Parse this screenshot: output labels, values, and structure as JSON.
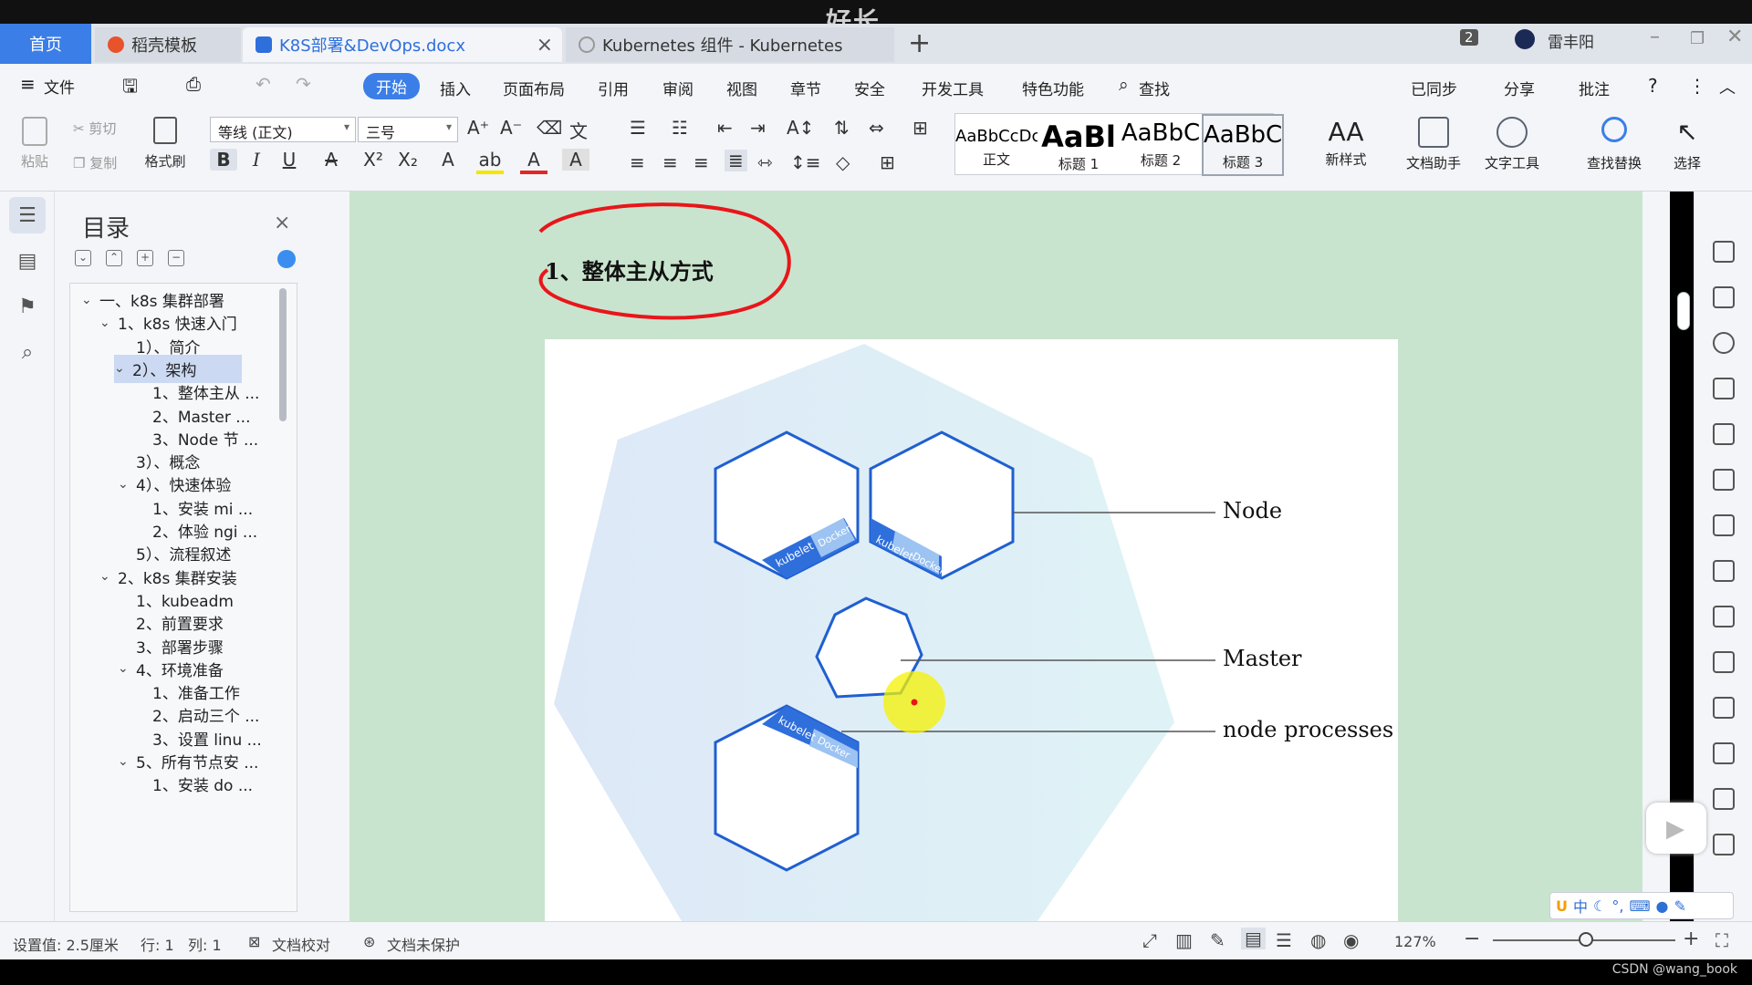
{
  "overlay_title": "好长",
  "tabs": {
    "home": "首页",
    "template": "稻壳模板",
    "doc": "K8S部署&DevOps.docx",
    "browser": "Kubernetes 组件 - Kubernetes",
    "badge": "2",
    "user": "雷丰阳"
  },
  "menu": {
    "file": "文件",
    "items": [
      "开始",
      "插入",
      "页面布局",
      "引用",
      "审阅",
      "视图",
      "章节",
      "安全",
      "开发工具",
      "特色功能"
    ],
    "search": "查找",
    "synced": "已同步",
    "share": "分享",
    "comment": "批注"
  },
  "ribbon": {
    "paste": "粘贴",
    "cut": "剪切",
    "copy": "复制",
    "format_painter": "格式刷",
    "font_name": "等线 (正文)",
    "font_size": "三号",
    "styles": [
      {
        "sample": "AaBbCcDc",
        "name": "正文"
      },
      {
        "sample": "AaBl",
        "name": "标题 1"
      },
      {
        "sample": "AaBbC",
        "name": "标题 2"
      },
      {
        "sample": "AaBbC",
        "name": "标题 3"
      }
    ],
    "new_style": "新样式",
    "doc_helper": "文档助手",
    "text_tools": "文字工具",
    "find_replace": "查找替换",
    "select": "选择"
  },
  "toc": {
    "title": "目录",
    "items": [
      {
        "level": 0,
        "toggle": "v",
        "label": "一、k8s 集群部署"
      },
      {
        "level": 1,
        "toggle": "v",
        "label": "1、k8s 快速入门"
      },
      {
        "level": 2,
        "toggle": "",
        "label": "1）、简介"
      },
      {
        "level": 2,
        "toggle": "v",
        "label": "2）、架构",
        "selected": true
      },
      {
        "level": 3,
        "toggle": "",
        "label": "1、整体主从 ..."
      },
      {
        "level": 3,
        "toggle": "",
        "label": "2、Master ..."
      },
      {
        "level": 3,
        "toggle": "",
        "label": "3、Node 节 ..."
      },
      {
        "level": 2,
        "toggle": "",
        "label": "3）、概念"
      },
      {
        "level": 2,
        "toggle": "v",
        "label": "4）、快速体验"
      },
      {
        "level": 3,
        "toggle": "",
        "label": "1、安装 mi ..."
      },
      {
        "level": 3,
        "toggle": "",
        "label": "2、体验 ngi ..."
      },
      {
        "level": 2,
        "toggle": "",
        "label": "5）、流程叙述"
      },
      {
        "level": 1,
        "toggle": "v",
        "label": "2、k8s 集群安装"
      },
      {
        "level": 2,
        "toggle": "",
        "label": "1、kubeadm"
      },
      {
        "level": 2,
        "toggle": "",
        "label": "2、前置要求"
      },
      {
        "level": 2,
        "toggle": "",
        "label": "3、部署步骤"
      },
      {
        "level": 2,
        "toggle": "v",
        "label": "4、环境准备"
      },
      {
        "level": 3,
        "toggle": "",
        "label": "1、准备工作"
      },
      {
        "level": 3,
        "toggle": "",
        "label": "2、启动三个 ..."
      },
      {
        "level": 3,
        "toggle": "",
        "label": "3、设置 linu ..."
      },
      {
        "level": 2,
        "toggle": "v",
        "label": "5、所有节点安 ..."
      },
      {
        "level": 3,
        "toggle": "",
        "label": "1、安装 do ..."
      }
    ]
  },
  "document": {
    "heading": "1、整体主从方式",
    "figure": {
      "label_node": "Node",
      "label_master": "Master",
      "label_processes": "node processes",
      "chip_kubelet": "kubelet",
      "chip_docker": "Docker"
    }
  },
  "status": {
    "setting": "设置值: 2.5厘米",
    "row": "行: 1",
    "col": "列: 1",
    "proofread": "文档校对",
    "unprotected": "文档未保护",
    "zoom": "127%"
  },
  "ime": {
    "lang": "中"
  },
  "watermark": "CSDN @wang_book",
  "colors": {
    "accent": "#3b7ee8",
    "page_bg": "#c9e4ce",
    "hex_stroke": "#1f5fd1",
    "annotation": "#e8161b"
  }
}
